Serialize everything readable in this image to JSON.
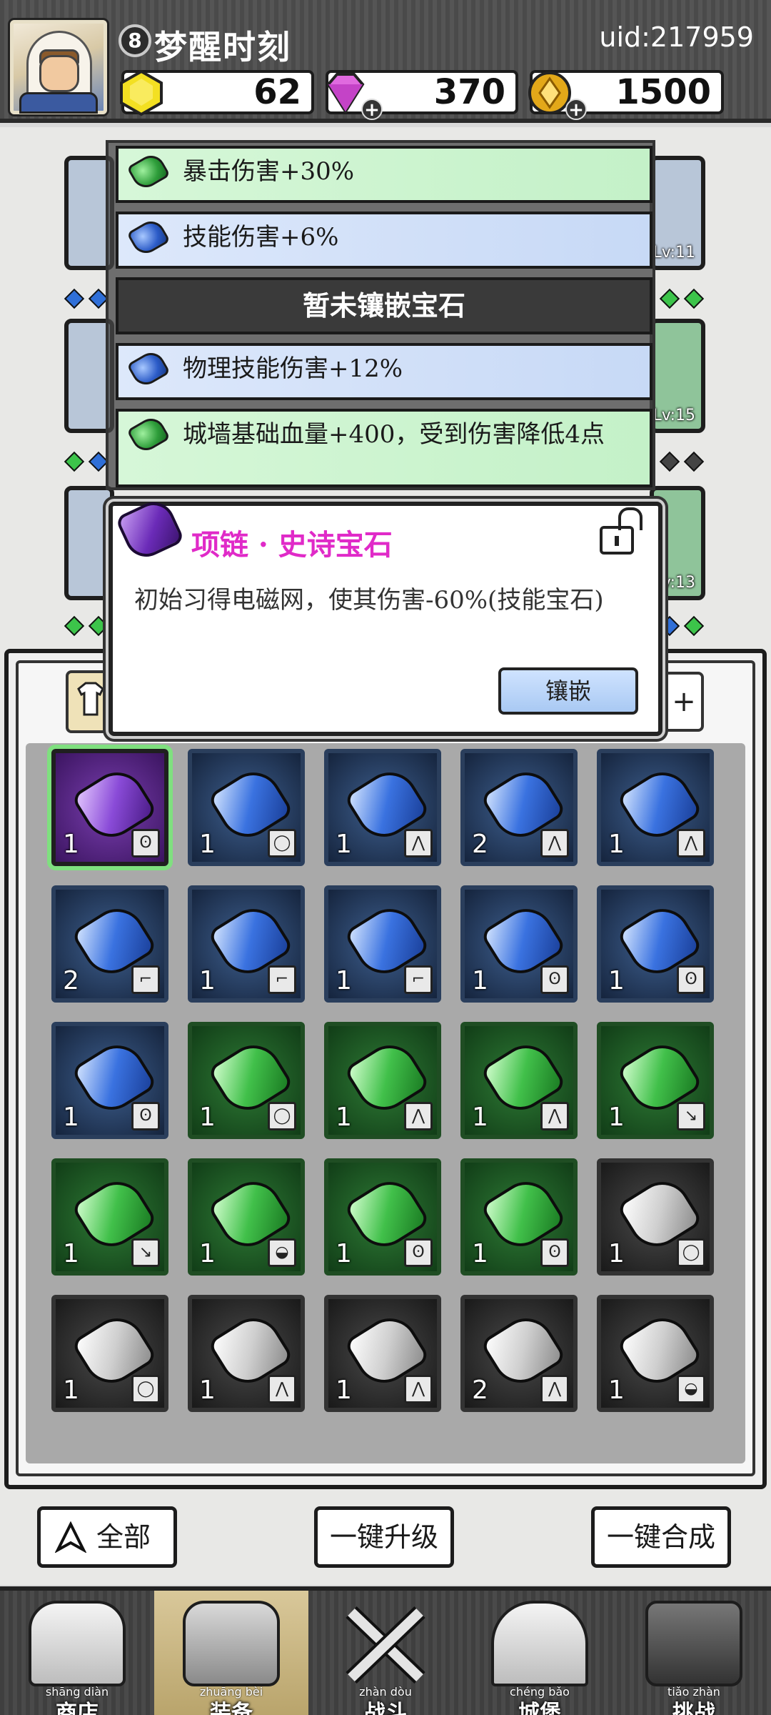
{
  "player": {
    "level": "8",
    "name": "梦醒时刻",
    "uid": "uid:217959"
  },
  "resources": [
    {
      "name": "yellow-gem",
      "value": "62",
      "color": "#f3e022",
      "has_plus": false
    },
    {
      "name": "purple-diamond",
      "value": "370",
      "color": "#e06adf",
      "has_plus": true
    },
    {
      "name": "gold-coin",
      "value": "1500",
      "color": "#e3a819",
      "has_plus": true
    }
  ],
  "equip_slots": [
    {
      "lv": "Lv:11"
    },
    {
      "lv": "Lv:15"
    },
    {
      "lv": "Lv:13"
    }
  ],
  "sockets": [
    {
      "kind": "green",
      "text": "暴击伤害+30%"
    },
    {
      "kind": "blue",
      "text": "技能伤害+6%"
    },
    {
      "kind": "empty",
      "text": "暂未镶嵌宝石"
    },
    {
      "kind": "blue",
      "text": "物理技能伤害+12%"
    },
    {
      "kind": "green",
      "text": "城墙基础血量+400，受到伤害降低4点"
    }
  ],
  "popup": {
    "title": "项链 · 史诗宝石",
    "description": "初始习得电磁网，使其伤害-60%(技能宝石)",
    "inlay_button": "镶嵌",
    "accent": "#e02ac8"
  },
  "inventory": {
    "right_tab": "+",
    "items": [
      {
        "color": "purple",
        "count": "1",
        "tag": "necklace-icon"
      },
      {
        "color": "blue",
        "count": "1",
        "tag": "ring-icon"
      },
      {
        "color": "blue",
        "count": "1",
        "tag": "armor-icon"
      },
      {
        "color": "blue",
        "count": "2",
        "tag": "armor-icon"
      },
      {
        "color": "blue",
        "count": "1",
        "tag": "armor-icon"
      },
      {
        "color": "blue",
        "count": "2",
        "tag": "boots-icon"
      },
      {
        "color": "blue",
        "count": "1",
        "tag": "boots-icon"
      },
      {
        "color": "blue",
        "count": "1",
        "tag": "boots-icon"
      },
      {
        "color": "blue",
        "count": "1",
        "tag": "necklace-icon"
      },
      {
        "color": "blue",
        "count": "1",
        "tag": "necklace-icon"
      },
      {
        "color": "blue",
        "count": "1",
        "tag": "necklace-icon"
      },
      {
        "color": "green",
        "count": "1",
        "tag": "ring-icon"
      },
      {
        "color": "green",
        "count": "1",
        "tag": "armor-icon"
      },
      {
        "color": "green",
        "count": "1",
        "tag": "armor-icon"
      },
      {
        "color": "green",
        "count": "1",
        "tag": "weapon-icon"
      },
      {
        "color": "green",
        "count": "1",
        "tag": "weapon-icon"
      },
      {
        "color": "green",
        "count": "1",
        "tag": "helmet-icon"
      },
      {
        "color": "green",
        "count": "1",
        "tag": "necklace-icon"
      },
      {
        "color": "green",
        "count": "1",
        "tag": "necklace-icon"
      },
      {
        "color": "white",
        "count": "1",
        "tag": "ring-icon"
      },
      {
        "color": "white",
        "count": "1",
        "tag": "ring-icon"
      },
      {
        "color": "white",
        "count": "1",
        "tag": "armor-icon"
      },
      {
        "color": "white",
        "count": "1",
        "tag": "armor-icon"
      },
      {
        "color": "white",
        "count": "2",
        "tag": "armor-icon"
      },
      {
        "color": "white",
        "count": "1",
        "tag": "helmet-icon"
      }
    ]
  },
  "actions": {
    "filter_all": "全部",
    "one_key_upgrade": "一键升级",
    "one_key_merge": "一键合成"
  },
  "nav": [
    {
      "pinyin": "shāng diàn",
      "label": "商店",
      "icon": "shop-icon",
      "active": false
    },
    {
      "pinyin": "zhuāng bèi",
      "label": "装备",
      "icon": "backpack-icon",
      "active": true
    },
    {
      "pinyin": "zhàn dòu",
      "label": "战斗",
      "icon": "crossed-swords-icon",
      "active": false
    },
    {
      "pinyin": "chéng bǎo",
      "label": "城堡",
      "icon": "castle-icon",
      "active": false
    },
    {
      "pinyin": "tiǎo zhàn",
      "label": "挑战",
      "icon": "locked-challenge-icon",
      "active": false
    }
  ]
}
